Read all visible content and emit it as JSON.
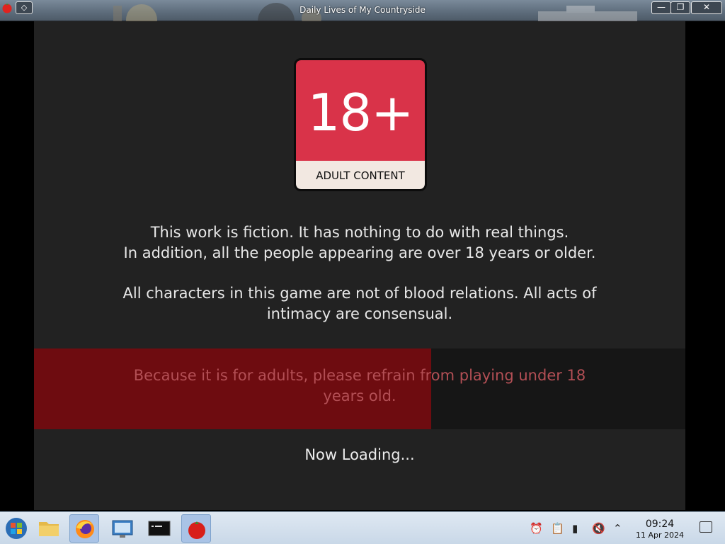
{
  "window": {
    "title": "Daily Lives of My Countryside",
    "sticky_glyph": "◇",
    "minimize_glyph": "—",
    "maximize_glyph": "❐",
    "close_glyph": "✕"
  },
  "badge": {
    "rating": "18+",
    "label": "ADULT CONTENT",
    "top_color": "#d93349",
    "bottom_color": "#f2e8e1"
  },
  "disclaimer": {
    "paragraph1": "This work is fiction. It has nothing to do with real things.\nIn addition, all the people appearing are over 18 years or older.",
    "paragraph2": "All characters in this game are not of blood relations. All acts of intimacy are consensual.",
    "warning": "Because it is for adults, please refrain from playing under 18 years old."
  },
  "loading": {
    "text": "Now Loading...",
    "progress": 0.61,
    "fill_color": "#6e0c10"
  },
  "taskbar": {
    "items": [
      {
        "name": "start-menu",
        "active": false
      },
      {
        "name": "file-manager",
        "active": false
      },
      {
        "name": "firefox",
        "active": true
      },
      {
        "name": "control-panel",
        "active": false
      },
      {
        "name": "terminal",
        "active": false
      },
      {
        "name": "game-app",
        "active": true
      }
    ],
    "clock_time": "09:24",
    "clock_date": "11 Apr 2024"
  }
}
